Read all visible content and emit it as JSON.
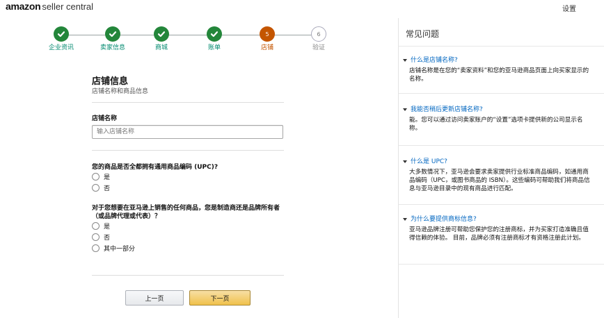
{
  "header": {
    "logo_amazon": "amazon",
    "logo_rest": "seller central",
    "settings_label": "设置"
  },
  "stepper": {
    "steps": [
      {
        "label": "企业资讯",
        "state": "done",
        "number": ""
      },
      {
        "label": "卖家信息",
        "state": "done",
        "number": ""
      },
      {
        "label": "商城",
        "state": "done",
        "number": ""
      },
      {
        "label": "账单",
        "state": "done",
        "number": ""
      },
      {
        "label": "店铺",
        "state": "active",
        "number": "5"
      },
      {
        "label": "验证",
        "state": "pending",
        "number": "6"
      }
    ]
  },
  "form": {
    "title": "店铺信息",
    "subtitle": "店铺名称和商品信息",
    "store_name_label": "店铺名称",
    "store_name_placeholder": "输入店铺名称",
    "store_name_value": "",
    "upc_question": "您的商品是否全都拥有通用商品编码 (UPC)?",
    "upc_options": [
      "是",
      "否"
    ],
    "brand_question_line1": "对于您想要在亚马逊上销售的任何商品，您是制造商还是品牌所有者",
    "brand_question_line2": "（或品牌代理或代表）？",
    "brand_options": [
      "是",
      "否",
      "其中一部分"
    ]
  },
  "buttons": {
    "prev_label": "上一页",
    "next_label": "下一页"
  },
  "faq": {
    "title": "常见问题",
    "items": [
      {
        "question": "什么是店铺名称?",
        "answer": "店铺名称是在您的“卖家资料”和您的亚马逊商品页面上向买家显示的名称。"
      },
      {
        "question": "我能否稍后更新店铺名称?",
        "answer": "能。您可以通过访问卖家账户的“设置”选项卡提供新的公司显示名称。"
      },
      {
        "question": "什么是 UPC?",
        "answer": "大多数情况下，亚马逊会要求卖家提供行业标准商品编码，如通用商品编码（UPC，或图书商品的 ISBN）。这些编码可帮助我们将商品信息与亚马逊目录中的现有商品进行匹配。"
      },
      {
        "question": "为什么要提供商标信息?",
        "answer": "亚马逊品牌注册可帮助您保护您的注册商标，并为买家打造准确且值得信赖的体验。 目前，品牌必须有注册商标才有资格注册此计划。"
      }
    ]
  },
  "colors": {
    "step_done": "#23863a",
    "step_active": "#c45500",
    "step_label": "#008a6f",
    "link": "#0066c0",
    "next_button": "#f0c14b"
  },
  "icons": {
    "step_done": "check-icon",
    "faq_expand": "triangle-down-icon"
  }
}
